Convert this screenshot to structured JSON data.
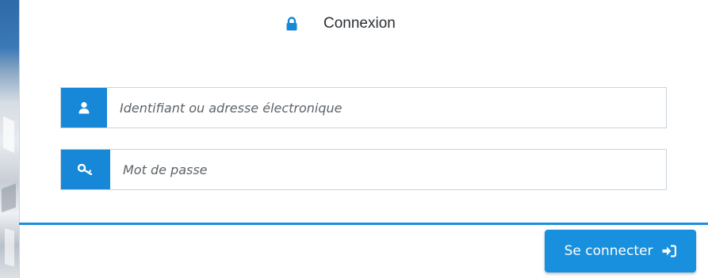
{
  "header": {
    "title": "Connexion",
    "icon": "lock-icon"
  },
  "form": {
    "username": {
      "icon": "user-icon",
      "placeholder": "Identifiant ou adresse électronique",
      "value": ""
    },
    "password": {
      "icon": "key-icon",
      "placeholder": "Mot de passe",
      "value": ""
    }
  },
  "footer": {
    "submit_label": "Se connecter",
    "submit_icon": "sign-in-icon"
  },
  "colors": {
    "accent": "#1787d8",
    "divider": "#1c8ee0",
    "button": "#1890dd",
    "title_text": "#2b2f33"
  }
}
